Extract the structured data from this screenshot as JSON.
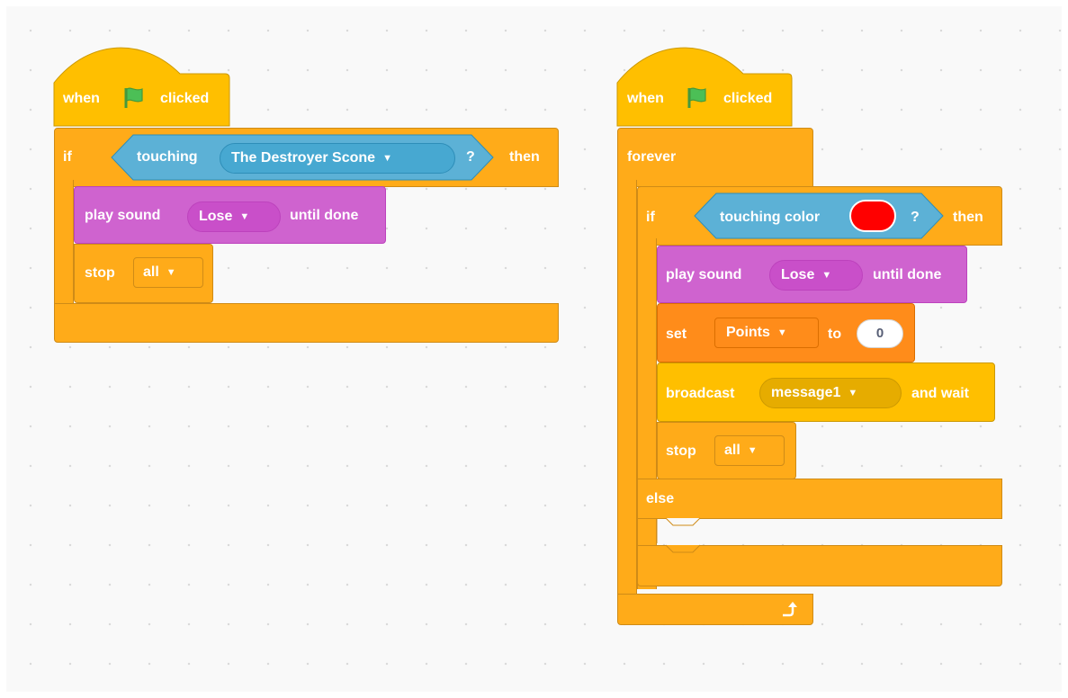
{
  "script1": {
    "hat": {
      "when": "when",
      "clicked": "clicked"
    },
    "if_block": {
      "if": "if",
      "then": "then"
    },
    "touching": {
      "label": "touching",
      "target": "The Destroyer Scone",
      "question": "?"
    },
    "play_sound": {
      "label": "play sound",
      "sound": "Lose",
      "suffix": "until done"
    },
    "stop": {
      "label": "stop",
      "option": "all"
    }
  },
  "script2": {
    "hat": {
      "when": "when",
      "clicked": "clicked"
    },
    "forever": {
      "label": "forever"
    },
    "if_else": {
      "if": "if",
      "then": "then",
      "else": "else"
    },
    "touching_color": {
      "label": "touching color",
      "color": "#ff0000",
      "question": "?"
    },
    "play_sound": {
      "label": "play sound",
      "sound": "Lose",
      "suffix": "until done"
    },
    "set_var": {
      "label": "set",
      "variable": "Points",
      "to": "to",
      "value": "0"
    },
    "broadcast": {
      "label": "broadcast",
      "message": "message1",
      "suffix": "and wait"
    },
    "stop": {
      "label": "stop",
      "option": "all"
    }
  },
  "colors": {
    "events": "#ffbf00",
    "control": "#ffab19",
    "sound": "#cf63cf",
    "variables": "#ff8c1a",
    "sensing": "#5cb1d6",
    "flag": "#4cbf56"
  },
  "icons": {
    "flag": "green-flag-icon",
    "dropdown": "dropdown-arrow-icon",
    "loop": "loop-arrow-icon"
  }
}
